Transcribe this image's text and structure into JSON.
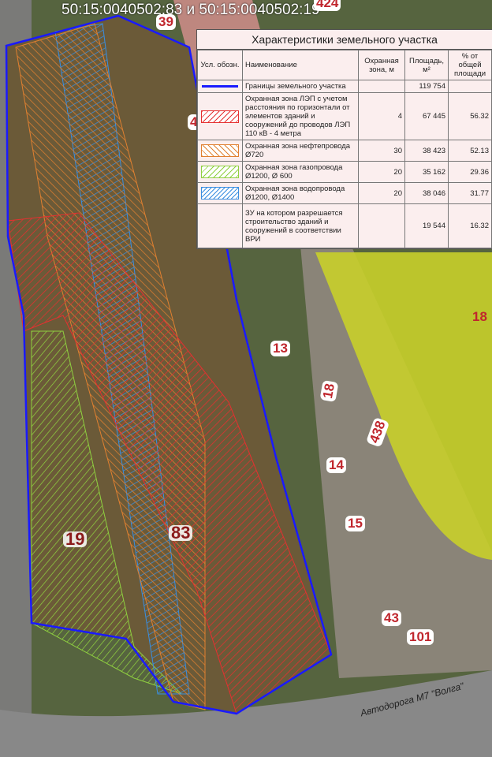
{
  "title": "50:15:0040502:83 и 50:15:0040502:19",
  "parcel_labels": {
    "p39": "39",
    "p424": "424",
    "p4": "4",
    "p13": "13",
    "p18a": "18",
    "p18b": "18",
    "p438": "438",
    "p14": "14",
    "p15": "15",
    "p19": "19",
    "p83": "83",
    "p43": "43",
    "p101": "101"
  },
  "road_label": "Автодорога М7 \"Волга\"",
  "legend": {
    "title": "Характеристики земельного участка",
    "headers": [
      "Усл. обозн.",
      "Наименование",
      "Охранная зона, м",
      "Площадь, м²",
      "% от общей площади"
    ],
    "rows": [
      {
        "symbol": "blue-line",
        "name": "Границы земельного участка",
        "zone": "",
        "area": "119 754",
        "percent": ""
      },
      {
        "symbol": "red-hatch",
        "name": "Охранная зона ЛЭП с учетом расстояния по горизонтали от элементов зданий и сооружений до проводов ЛЭП 110 кВ - 4 метра",
        "zone": "4",
        "area": "67 445",
        "percent": "56.32"
      },
      {
        "symbol": "orange-hatch",
        "name": "Охранная зона нефтепровода Ø720",
        "zone": "30",
        "area": "38 423",
        "percent": "52.13"
      },
      {
        "symbol": "green-hatch",
        "name": "Охранная зона газопровода Ø1200, Ø 600",
        "zone": "20",
        "area": "35 162",
        "percent": "29.36"
      },
      {
        "symbol": "blue-hatch",
        "name": "Охранная зона водопровода Ø1200, Ø1400",
        "zone": "20",
        "area": "38 046",
        "percent": "31.77"
      },
      {
        "symbol": "none",
        "name": "ЗУ на котором разрешается строительство зданий и сооружений в соответствии ВРИ",
        "zone": "",
        "area": "19 544",
        "percent": "16.32"
      }
    ]
  },
  "colors": {
    "boundary": "#1a1aff",
    "power": "#e53030",
    "oil": "#e08030",
    "gas": "#8fd040",
    "water": "#3a8ee0",
    "yellow_zone": "#d8e020"
  }
}
